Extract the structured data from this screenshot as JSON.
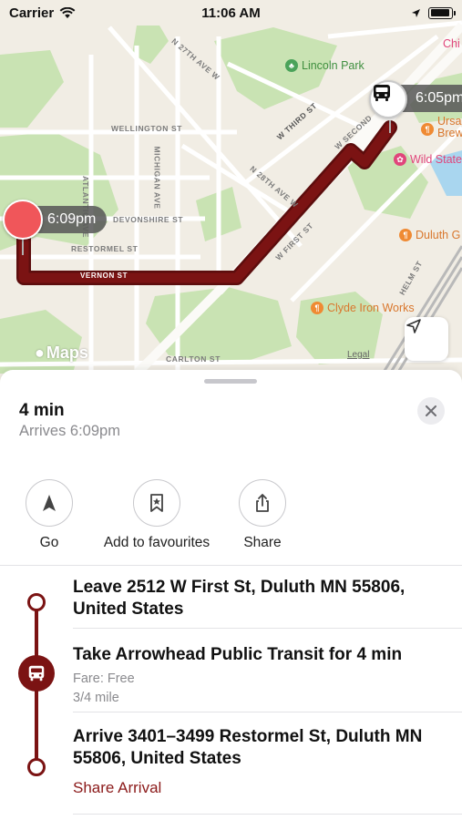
{
  "status_bar": {
    "carrier": "Carrier",
    "time": "11:06 AM",
    "battery_level": 0.95
  },
  "map": {
    "streets": {
      "n27th": "N 27TH AVE W",
      "wellington": "WELLINGTON ST",
      "michigan": "MICHIGAN AVE",
      "atlantic": "ATLANTIC AVE",
      "devonshire": "DEVONSHIRE ST",
      "restormel": "RESTORMEL ST",
      "vernon": "VERNON ST",
      "w_third": "W THIRD ST",
      "w_second": "W SECOND",
      "n28th": "N 28TH AVE W",
      "w_first": "W FIRST ST",
      "helm": "HELM ST",
      "carlton": "CARLTON ST"
    },
    "pois": {
      "lincoln_park": "Lincoln Park",
      "ursa": "Ursa",
      "brew": "Brew",
      "wild_state": "Wild State",
      "duluth_g": "Duluth G",
      "clyde": "Clyde Iron Works",
      "chi": "Chi"
    },
    "origin_time": "6:09pm",
    "transit_time": "6:05pm",
    "maps_brand": "Maps",
    "legal": "Legal",
    "colors": {
      "route": "#7b1313",
      "park": "#c9e3b3",
      "water": "#a9d6ef"
    }
  },
  "sheet": {
    "eta": "4 min",
    "arrives": "Arrives 6:09pm",
    "actions": [
      {
        "label": "Go",
        "icon": "navigation-arrow-icon"
      },
      {
        "label": "Add to favourites",
        "icon": "bookmark-star-icon"
      },
      {
        "label": "Share",
        "icon": "share-icon"
      }
    ],
    "steps": [
      {
        "title": "Leave 2512 W First St, Duluth MN 55806, United States"
      },
      {
        "title": "Take Arrowhead Public Transit for 4 min",
        "fare": "Fare: Free",
        "distance": "3/4 mile"
      },
      {
        "title": "Arrive 3401–3499 Restormel St, Duluth MN 55806, United States",
        "link": "Share Arrival"
      }
    ],
    "accent": "#8b1a1a"
  }
}
